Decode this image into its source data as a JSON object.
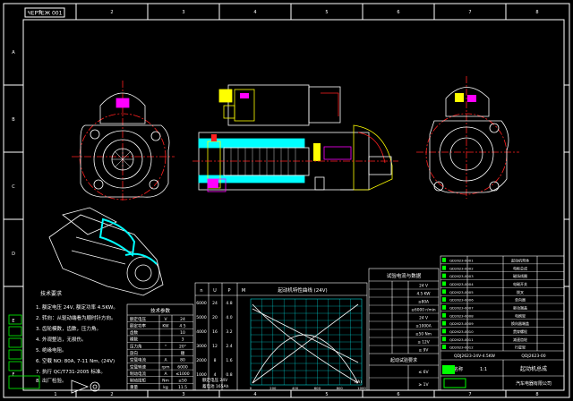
{
  "sheet": {
    "stamp_label": "ЧЕРТЕЖ 001",
    "zone_numbers_top": [
      "1",
      "2",
      "3",
      "4",
      "5",
      "6",
      "7",
      "8"
    ],
    "zone_numbers_bottom": [
      "1",
      "2",
      "3",
      "4",
      "5",
      "6",
      "7",
      "8"
    ],
    "zone_letters": [
      "A",
      "B",
      "C",
      "D",
      "E",
      "F"
    ]
  },
  "tech_notes": {
    "heading": "技术要求",
    "lines": [
      "1. 额定电压 24V, 额定功率 4.5KW。",
      "2. 转向：从驱动端看为顺时针方向。",
      "3. 齿轮模数，齿数，压力角。",
      "4. 外观整洁，无损伤。",
      "5. 绝缘电阻。",
      "6. 空载 NO: 80A, 7-11 Nm, (24V)",
      "7. 执行 QC/T731-2005 标准。",
      "8. 出厂检验。"
    ]
  },
  "param_table": {
    "title": "技术参数",
    "rows": [
      [
        "额定电压",
        "V",
        "24"
      ],
      [
        "额定功率",
        "KW",
        "4.5"
      ],
      [
        "齿数",
        "",
        "10"
      ],
      [
        "模数",
        "",
        "3"
      ],
      [
        "压力角",
        "°",
        "20°"
      ],
      [
        "旋向",
        "",
        "顺"
      ],
      [
        "空载电流",
        "A",
        "80"
      ],
      [
        "空载转速",
        "rpm",
        "6000"
      ],
      [
        "制动电流",
        "A",
        "≤1000"
      ],
      [
        "制动扭矩",
        "Nm",
        "≥50"
      ],
      [
        "重量",
        "kg",
        "11.5"
      ]
    ]
  },
  "char_chart": {
    "title": "起动机特性曲线 (24V)",
    "y_axis_labels": [
      "n",
      "U",
      "P",
      "M"
    ],
    "y_ticks_left": [
      "6000",
      "5000",
      "4000",
      "3000",
      "2000",
      "1000"
    ],
    "y_ticks_mid": [
      "24",
      "20",
      "16",
      "12",
      "8",
      "4"
    ],
    "y_ticks_right": [
      "4.8",
      "4.0",
      "3.2",
      "2.4",
      "1.6",
      "0.8"
    ],
    "x_ticks": [
      "0",
      "200",
      "400",
      "600",
      "800",
      "1000"
    ],
    "x_label": "I(A)",
    "footer_left": "额定电压 24V",
    "footer_right": "蓄电池 165Ah"
  },
  "check_table": {
    "title": "试验电流与数据",
    "rows": [
      [
        "",
        "",
        "24 V"
      ],
      [
        "",
        "",
        "4.5 KW"
      ],
      [
        "",
        "",
        "≤80A"
      ],
      [
        "",
        "",
        "≥6000 r/min"
      ],
      [
        "",
        "",
        "24 V"
      ],
      [
        "",
        "",
        "≤1000A"
      ],
      [
        "",
        "",
        "≥50 Nm"
      ],
      [
        "",
        "",
        "≤ 12V"
      ],
      [
        "",
        "",
        "≥ 9V"
      ]
    ],
    "mid_title": "起动试验要求",
    "bottom_rows": [
      [
        "",
        "≤ 6V"
      ],
      [
        "",
        "≥ 1V"
      ]
    ]
  },
  "bom": {
    "rows": [
      [
        "QD2623-0001",
        "",
        "起动机壳体"
      ],
      [
        "QD2623-0002",
        "",
        "电枢总成"
      ],
      [
        "QD2623-0003",
        "",
        "磁场线圈"
      ],
      [
        "QD2623-0004",
        "",
        "电磁开关"
      ],
      [
        "QD2623-0005",
        "",
        "拨叉"
      ],
      [
        "QD2623-0006",
        "",
        "单向器"
      ],
      [
        "QD2623-0007",
        "",
        "驱动端盖"
      ],
      [
        "QD2623-0008",
        "",
        "电刷架"
      ],
      [
        "QD2623-0009",
        "",
        "换向器端盖"
      ],
      [
        "QD2623-0010",
        "",
        "贯穿螺栓"
      ],
      [
        "QD2623-0011",
        "",
        "减速齿轮"
      ],
      [
        "QD2623-0012",
        "",
        "行星架"
      ]
    ],
    "header_code": "QDJ2623-24V-4.5KW",
    "header_title": "起动机总成",
    "name_label": "名称",
    "scale": "1:1",
    "drawing_no": "QDJ2623-00",
    "company": "汽车电器有限公司"
  },
  "colors": {
    "bg": "#000000",
    "frame": "#ffffff",
    "outline": "#ffffff",
    "center": "#ff2020",
    "cyan": "#00ffff",
    "yellow": "#ffff00",
    "magenta": "#ff00ff",
    "green": "#00ff00"
  }
}
